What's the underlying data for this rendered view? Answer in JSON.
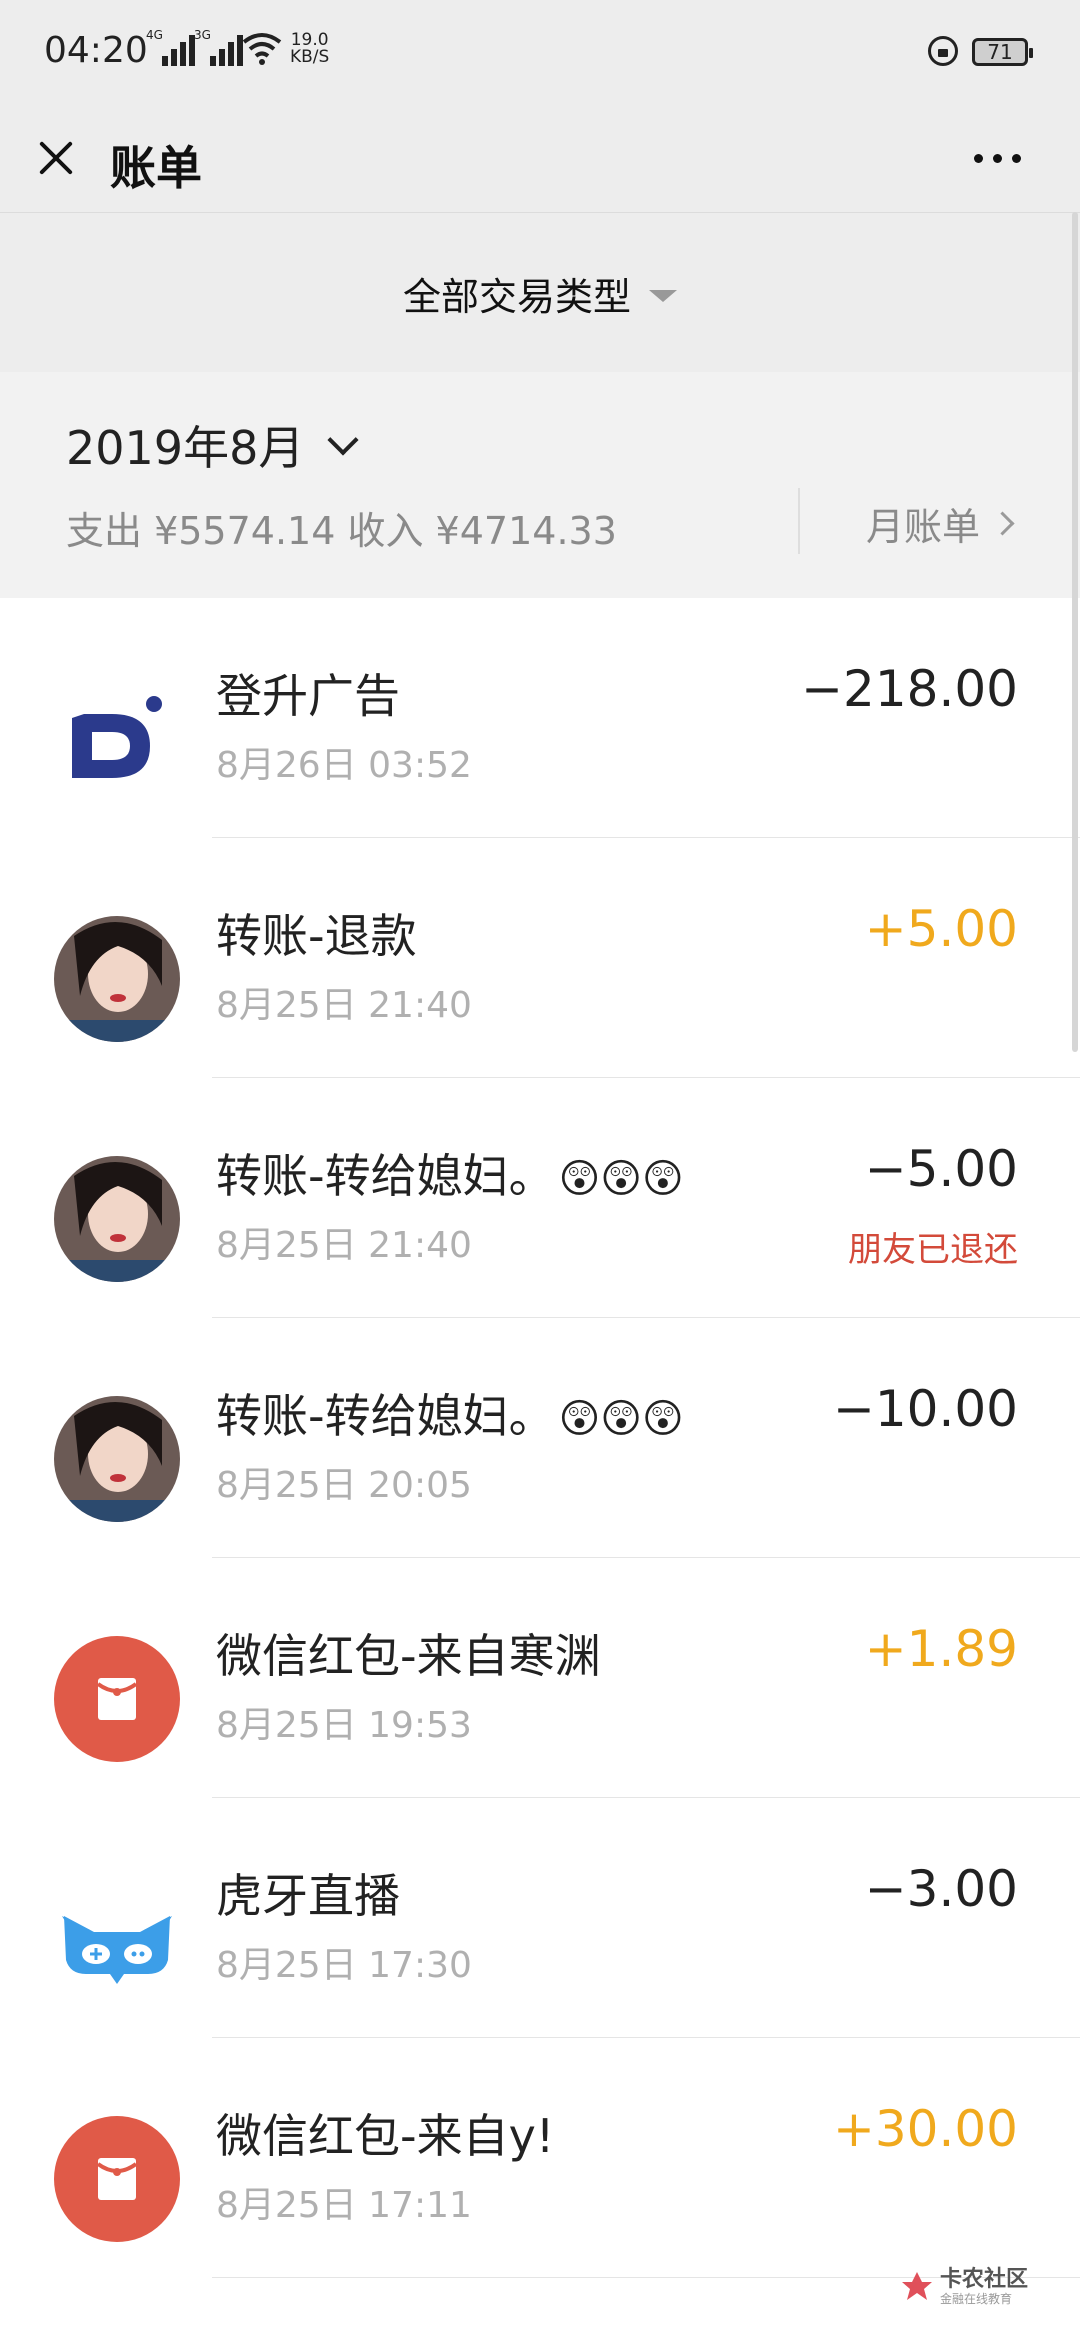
{
  "status_bar": {
    "time": "04:20",
    "signal1_label": "4G",
    "signal2_label": "3G",
    "speed_value": "19.0",
    "speed_unit": "KB/S",
    "battery": "71"
  },
  "nav": {
    "title": "账单"
  },
  "filter": {
    "label": "全部交易类型"
  },
  "month": {
    "label": "2019年8月",
    "summary": "支出 ¥5574.14 收入 ¥4714.33",
    "monthly_bill": "月账单"
  },
  "transactions": [
    {
      "title": "登升广告",
      "emoji": "",
      "time": "8月26日 03:52",
      "amount": "−218.00",
      "direction": "expense",
      "status": "",
      "icon": "app-logo-icon"
    },
    {
      "title": "转账-退款",
      "emoji": "",
      "time": "8月25日 21:40",
      "amount": "+5.00",
      "direction": "income",
      "status": "",
      "icon": "user-avatar"
    },
    {
      "title": "转账-转给媳妇。",
      "emoji": "😲😲😲",
      "time": "8月25日 21:40",
      "amount": "−5.00",
      "direction": "expense",
      "status": "朋友已退还",
      "icon": "user-avatar"
    },
    {
      "title": "转账-转给媳妇。",
      "emoji": "😲😲😲",
      "time": "8月25日 20:05",
      "amount": "−10.00",
      "direction": "expense",
      "status": "",
      "icon": "user-avatar"
    },
    {
      "title": "微信红包-来自寒渊",
      "emoji": "",
      "time": "8月25日 19:53",
      "amount": "+1.89",
      "direction": "income",
      "status": "",
      "icon": "red-packet-icon"
    },
    {
      "title": "虎牙直播",
      "emoji": "",
      "time": "8月25日 17:30",
      "amount": "−3.00",
      "direction": "expense",
      "status": "",
      "icon": "huya-logo-icon"
    },
    {
      "title": "微信红包-来自y!",
      "emoji": "",
      "time": "8月25日 17:11",
      "amount": "+30.00",
      "direction": "income",
      "status": "",
      "icon": "red-packet-icon"
    }
  ],
  "watermark": {
    "main": "卡农社区",
    "sub": "金融在线教育"
  },
  "colors": {
    "income": "#f0a91d",
    "refund_status": "#d34a3a",
    "red_packet": "#e05a48",
    "huya_blue": "#3c9ee8",
    "header_bg": "#ededed"
  }
}
